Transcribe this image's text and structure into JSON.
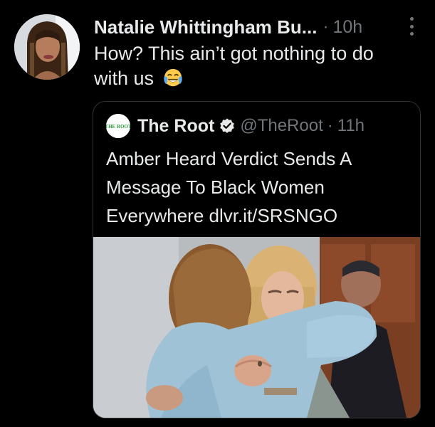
{
  "tweet": {
    "author_name": "Natalie Whittingham Bu...",
    "separator": "·",
    "time": "10h",
    "text": "How? This ain’t got nothing to do with us",
    "emoji": "face-with-tears-of-joy-icon"
  },
  "quote": {
    "logo_text": "THE ROOT",
    "name": "The Root",
    "handle": "@TheRoot",
    "separator": "·",
    "time": "11h",
    "text": "Amber Heard Verdict Sends A Message To Black Women Everywhere dlvr.it/SRSNGO",
    "media": "courtroom-hug-photo"
  },
  "colors": {
    "background": "#000000",
    "text_primary": "#e7e9ea",
    "text_secondary": "#71767b",
    "card_border": "#2f3336",
    "verified": "#e7e9ea",
    "root_green": "#2a9d3a"
  }
}
